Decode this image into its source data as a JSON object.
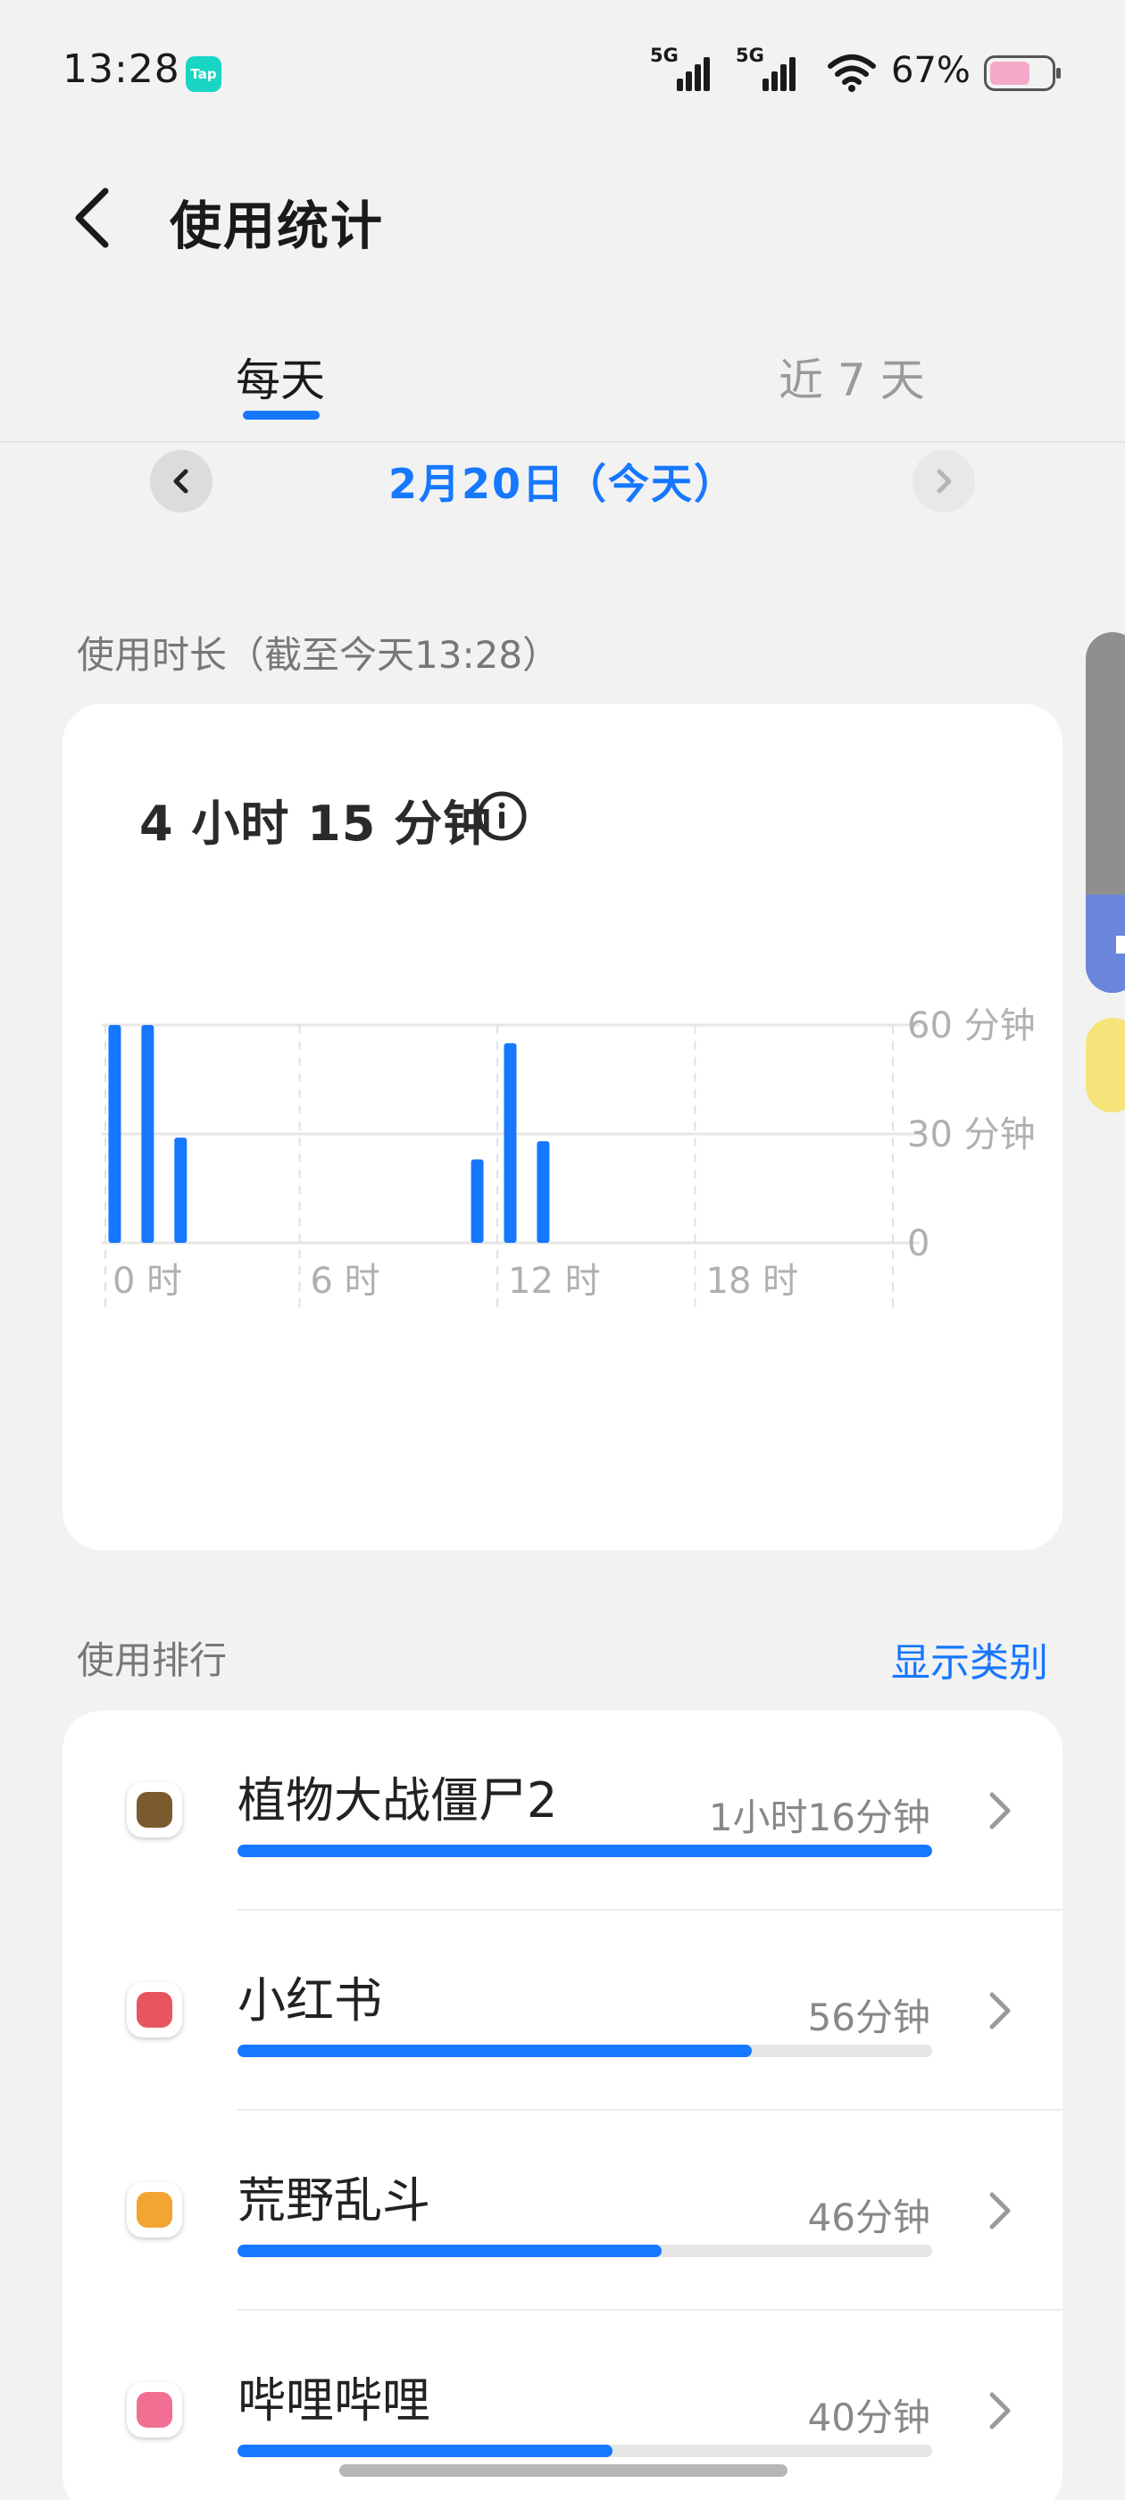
{
  "status_bar": {
    "time": "13:28",
    "app_badge": "Tap",
    "network_1": "5G",
    "network_2": "5G",
    "battery_percent": "67%",
    "battery_level": 0.67
  },
  "header": {
    "title": "使用统计",
    "back_icon": "chevron-left-icon"
  },
  "tabs": [
    {
      "label": "每天",
      "active": true
    },
    {
      "label": "近 7 天",
      "active": false
    }
  ],
  "date_nav": {
    "label": "2月20日（今天）",
    "prev_icon": "chevron-left-icon",
    "next_icon": "chevron-right-icon"
  },
  "usage": {
    "section_label": "使用时长（截至今天13:28）",
    "total": "4 小时 15 分钟",
    "info_icon": "info-icon"
  },
  "chart_data": {
    "type": "bar",
    "xlabel": "",
    "ylabel": "",
    "x_ticks": [
      "0 时",
      "6 时",
      "12 时",
      "18 时"
    ],
    "y_ticks": [
      "60 分钟",
      "30 分钟",
      "0"
    ],
    "ylim": [
      0,
      60
    ],
    "xlim_hours": [
      0,
      24
    ],
    "grid": true,
    "bar_color": "#1677ff",
    "bars": [
      {
        "hour": 0,
        "minutes": 60
      },
      {
        "hour": 1,
        "minutes": 60
      },
      {
        "hour": 2,
        "minutes": 29
      },
      {
        "hour": 11,
        "minutes": 23
      },
      {
        "hour": 12,
        "minutes": 55
      },
      {
        "hour": 13,
        "minutes": 28
      }
    ]
  },
  "ranking": {
    "section_label": "使用排行",
    "show_category": "显示类别",
    "items": [
      {
        "name": "植物大战僵尸2",
        "time": "1小时16分钟",
        "fraction": 1.0,
        "icon": "pvz-app-icon",
        "icon_color": "#7a5a2e"
      },
      {
        "name": "小红书",
        "time": "56分钟",
        "fraction": 0.74,
        "icon": "xiaohongshu-app-icon",
        "icon_color": "#e8555f"
      },
      {
        "name": "荒野乱斗",
        "time": "46分钟",
        "fraction": 0.61,
        "icon": "brawl-stars-app-icon",
        "icon_color": "#f2a531"
      },
      {
        "name": "哔哩哔哩",
        "time": "40分钟",
        "fraction": 0.54,
        "icon": "bilibili-app-icon",
        "icon_color": "#f06f93"
      }
    ]
  },
  "colors": {
    "accent": "#1677ff",
    "background": "#f2f2f2"
  }
}
